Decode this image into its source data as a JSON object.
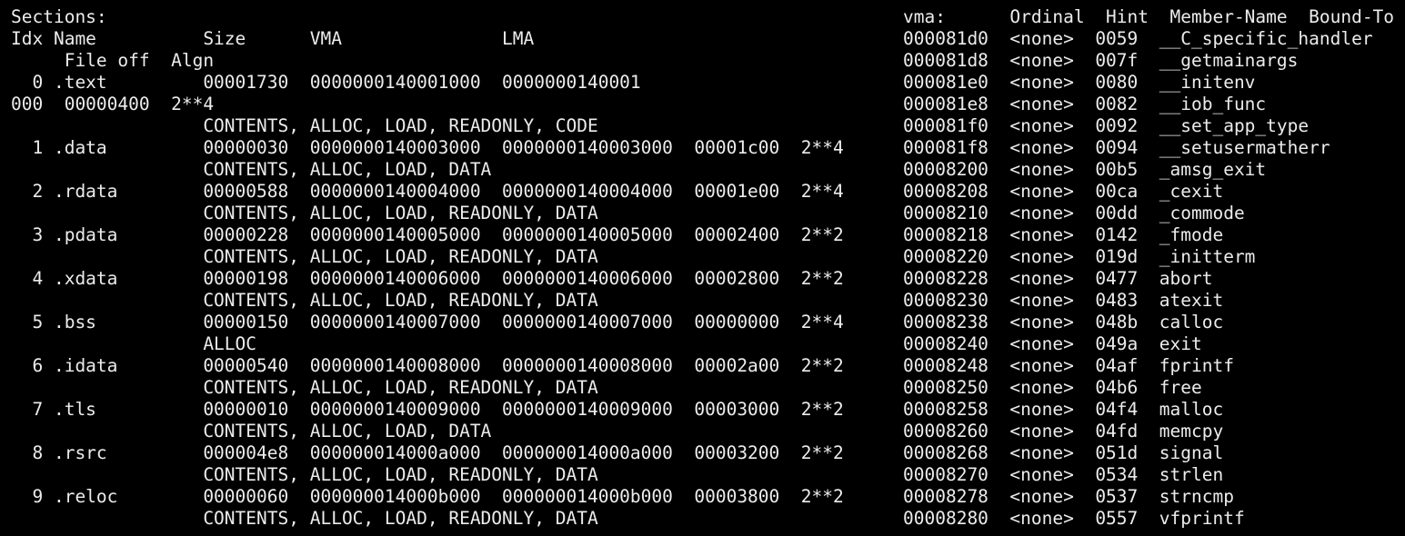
{
  "terminal": {
    "background": "#000000",
    "foreground": "#ececec",
    "sections_dump": {
      "title": "Sections:",
      "header_1": "Idx Name          Size      VMA               LMA",
      "header_2": "     File off  Algn",
      "lines": [
        "  0 .text         00001730  0000000140001000  0000000140001",
        "000  00000400  2**4",
        "                  CONTENTS, ALLOC, LOAD, READONLY, CODE",
        "  1 .data         00000030  0000000140003000  0000000140003000  00001c00  2**4",
        "                  CONTENTS, ALLOC, LOAD, DATA",
        "  2 .rdata        00000588  0000000140004000  0000000140004000  00001e00  2**4",
        "                  CONTENTS, ALLOC, LOAD, READONLY, DATA",
        "  3 .pdata        00000228  0000000140005000  0000000140005000  00002400  2**2",
        "                  CONTENTS, ALLOC, LOAD, READONLY, DATA",
        "  4 .xdata        00000198  0000000140006000  0000000140006000  00002800  2**2",
        "                  CONTENTS, ALLOC, LOAD, READONLY, DATA",
        "  5 .bss          00000150  0000000140007000  0000000140007000  00000000  2**4",
        "                  ALLOC",
        "  6 .idata        00000540  0000000140008000  0000000140008000  00002a00  2**2",
        "                  CONTENTS, ALLOC, LOAD, READONLY, DATA",
        "  7 .tls          00000010  0000000140009000  0000000140009000  00003000  2**2",
        "                  CONTENTS, ALLOC, LOAD, DATA",
        "  8 .rsrc         000004e8  000000014000a000  000000014000a000  00003200  2**2",
        "                  CONTENTS, ALLOC, LOAD, READONLY, DATA",
        "  9 .reloc        00000060  000000014000b000  000000014000b000  00003800  2**2",
        "                  CONTENTS, ALLOC, LOAD, READONLY, DATA"
      ]
    },
    "import_table": {
      "header": "vma:      Ordinal  Hint  Member-Name  Bound-To",
      "lines": [
        "000081d0  <none>  0059  __C_specific_handler",
        "000081d8  <none>  007f  __getmainargs",
        "000081e0  <none>  0080  __initenv",
        "000081e8  <none>  0082  __iob_func",
        "000081f0  <none>  0092  __set_app_type",
        "000081f8  <none>  0094  __setusermatherr",
        "00008200  <none>  00b5  _amsg_exit",
        "00008208  <none>  00ca  _cexit",
        "00008210  <none>  00dd  _commode",
        "00008218  <none>  0142  _fmode",
        "00008220  <none>  019d  _initterm",
        "00008228  <none>  0477  abort",
        "00008230  <none>  0483  atexit",
        "00008238  <none>  048b  calloc",
        "00008240  <none>  049a  exit",
        "00008248  <none>  04af  fprintf",
        "00008250  <none>  04b6  free",
        "00008258  <none>  04f4  malloc",
        "00008260  <none>  04fd  memcpy",
        "00008268  <none>  051d  signal",
        "00008270  <none>  0534  strlen",
        "00008278  <none>  0537  strncmp",
        "00008280  <none>  0557  vfprintf"
      ]
    }
  }
}
